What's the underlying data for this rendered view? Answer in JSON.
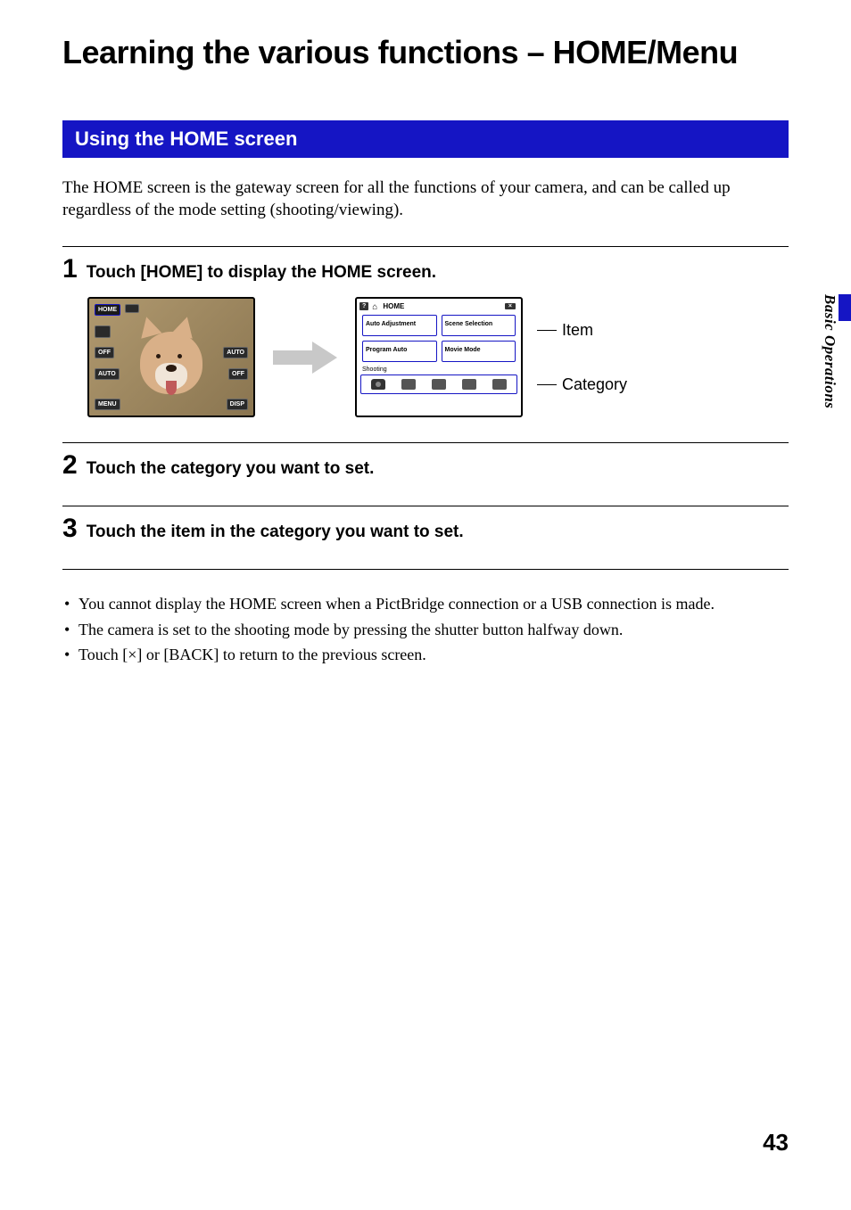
{
  "title": "Learning the various functions – HOME/Menu",
  "section_heading": "Using the HOME screen",
  "intro": "The HOME screen is the gateway screen for all the functions of your camera, and can be called up regardless of the mode setting (shooting/viewing).",
  "side_tab": "Basic Operations",
  "page_number": "43",
  "steps": [
    {
      "num": "1",
      "text": "Touch [HOME] to display the HOME screen."
    },
    {
      "num": "2",
      "text": "Touch the category you want to set."
    },
    {
      "num": "3",
      "text": "Touch the item in the category you want to set."
    }
  ],
  "camera_buttons": {
    "home": "HOME",
    "menu": "MENU",
    "disp": "DISP",
    "off": "OFF",
    "auto": "AUTO",
    "flash": "AUTO",
    "timer": "OFF"
  },
  "home_screen": {
    "help": "?",
    "title": "HOME",
    "close": "×",
    "items": [
      "Auto Adjustment",
      "Scene Selection",
      "Program Auto",
      "Movie Mode"
    ],
    "category_label": "Shooting"
  },
  "callouts": {
    "item": "Item",
    "category": "Category"
  },
  "notes": [
    "You cannot display the HOME screen when a PictBridge connection or a USB connection is made.",
    "The camera is set to the shooting mode by pressing the shutter button halfway down.",
    "Touch [×] or [BACK] to return to the previous screen."
  ]
}
